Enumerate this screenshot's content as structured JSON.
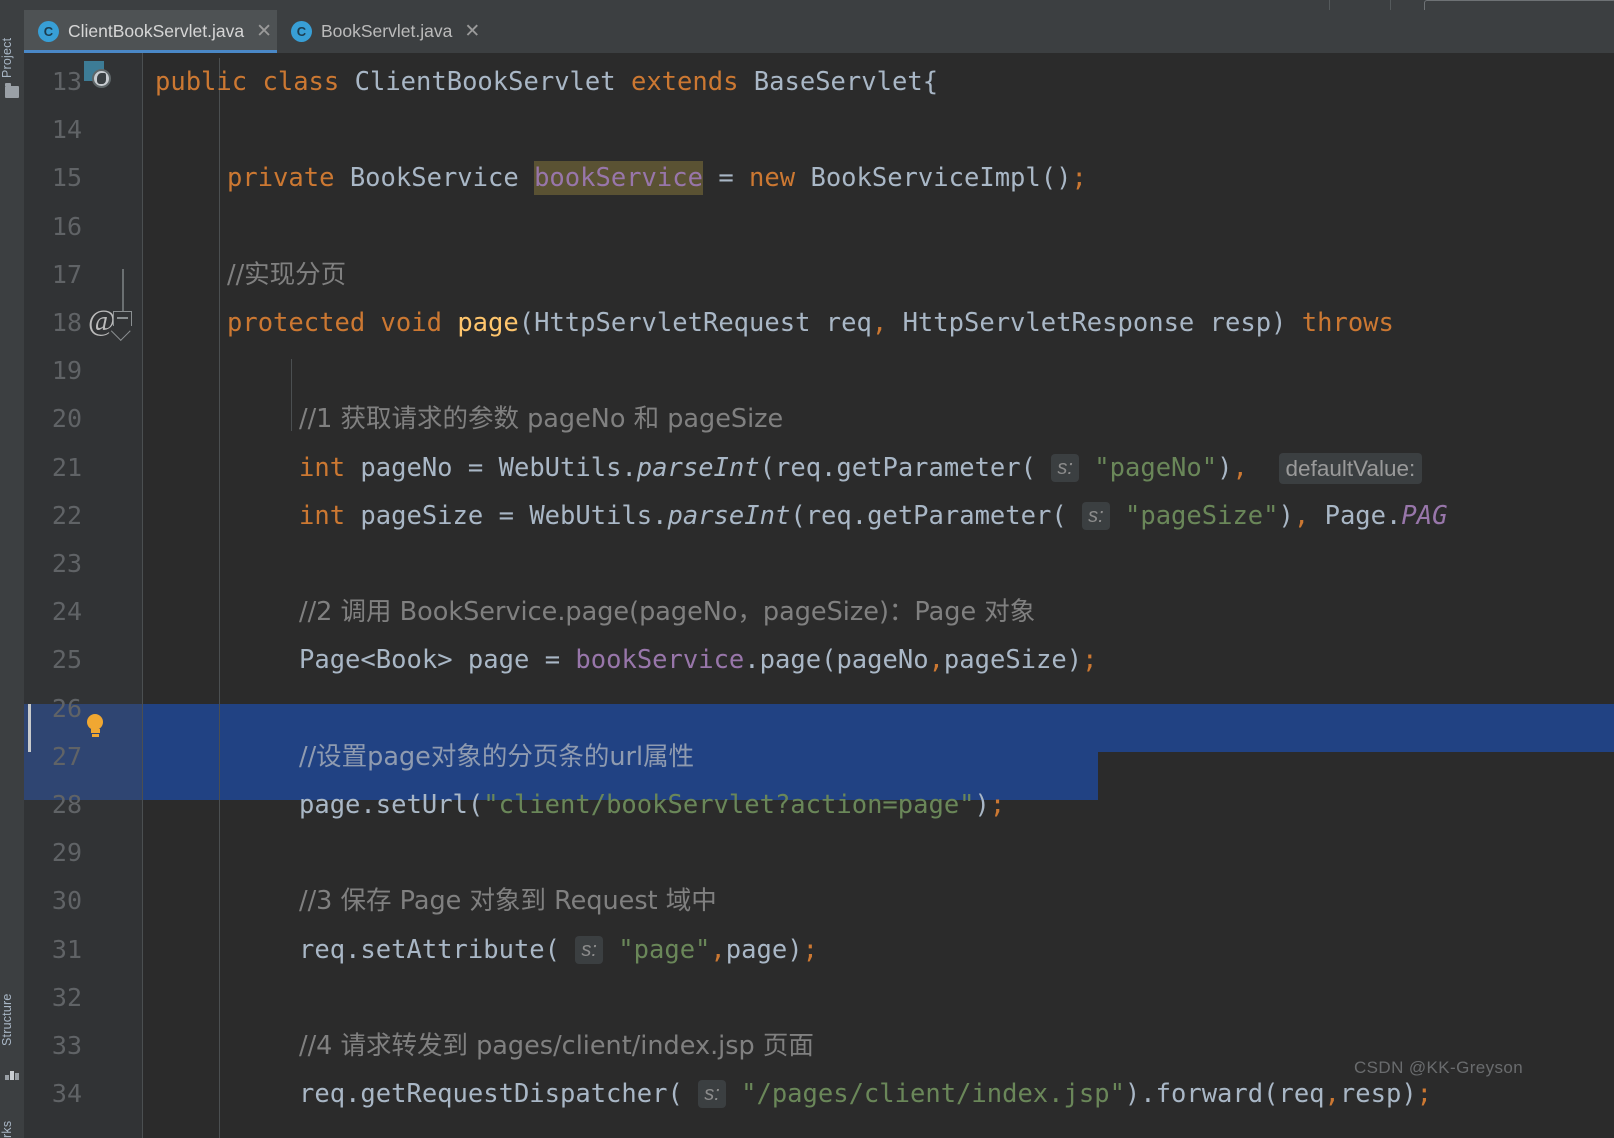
{
  "window": {
    "app": "IntelliJ IDEA",
    "theme_background": "#2b2b2b",
    "accent": "#4a88c7"
  },
  "toolwindows": {
    "left": [
      {
        "label": "Project",
        "icon": "folder-icon"
      },
      {
        "label": "Structure",
        "icon": "structure-icon"
      },
      {
        "label": "rks",
        "icon": "bookmarks-icon"
      }
    ]
  },
  "tabs": [
    {
      "label": "ClientBookServlet.java",
      "icon": "java-class-icon",
      "icon_letter": "C",
      "close": "✕",
      "active": true
    },
    {
      "label": "BookServlet.java",
      "icon": "java-class-icon",
      "icon_letter": "C",
      "close": "✕",
      "active": false
    }
  ],
  "editor": {
    "first_line": 13,
    "last_line": 34,
    "selected_lines": [
      27,
      28
    ],
    "gutter": {
      "servlet_marker_line": 13,
      "override_marker_line": 18,
      "override_glyph": "@",
      "fold_marker_line": 18,
      "intention_bulb_line": 27
    },
    "line_numbers": [
      "13",
      "14",
      "15",
      "16",
      "17",
      "18",
      "19",
      "20",
      "21",
      "22",
      "23",
      "24",
      "25",
      "26",
      "27",
      "28",
      "29",
      "30",
      "31",
      "32",
      "33",
      "34"
    ],
    "lines": [
      {
        "n": "13",
        "segments": [
          {
            "t": "public",
            "c": "kw"
          },
          {
            "t": " ",
            "c": "op"
          },
          {
            "t": "class",
            "c": "kw"
          },
          {
            "t": " ",
            "c": "op"
          },
          {
            "t": "ClientBookServlet",
            "c": "cls"
          },
          {
            "t": " ",
            "c": "op"
          },
          {
            "t": "extends",
            "c": "kw"
          },
          {
            "t": " ",
            "c": "op"
          },
          {
            "t": "BaseServlet",
            "c": "cls"
          },
          {
            "t": "{",
            "c": "punc"
          }
        ]
      },
      {
        "n": "14",
        "segments": []
      },
      {
        "n": "15",
        "indent": 1,
        "segments": [
          {
            "t": "private",
            "c": "kw"
          },
          {
            "t": " ",
            "c": "op"
          },
          {
            "t": "BookService",
            "c": "cls"
          },
          {
            "t": " ",
            "c": "op"
          },
          {
            "t": "bookService",
            "c": "fld hl-occurrence"
          },
          {
            "t": " ",
            "c": "op"
          },
          {
            "t": "=",
            "c": "op"
          },
          {
            "t": " ",
            "c": "op"
          },
          {
            "t": "new",
            "c": "kw"
          },
          {
            "t": " ",
            "c": "op"
          },
          {
            "t": "BookServiceImpl",
            "c": "cls"
          },
          {
            "t": "()",
            "c": "punc"
          },
          {
            "t": ";",
            "c": "semi"
          }
        ]
      },
      {
        "n": "16",
        "segments": []
      },
      {
        "n": "17",
        "indent": 1,
        "segments": [
          {
            "t": "//实现分页",
            "c": "cmt cmt-cn"
          }
        ]
      },
      {
        "n": "18",
        "indent": 1,
        "segments": [
          {
            "t": "protected",
            "c": "kw"
          },
          {
            "t": " ",
            "c": "op"
          },
          {
            "t": "void",
            "c": "kw"
          },
          {
            "t": " ",
            "c": "op"
          },
          {
            "t": "page",
            "c": "mth"
          },
          {
            "t": "(",
            "c": "punc"
          },
          {
            "t": "HttpServletRequest",
            "c": "cls"
          },
          {
            "t": " req",
            "c": "op"
          },
          {
            "t": ",",
            "c": "semi"
          },
          {
            "t": " ",
            "c": "op"
          },
          {
            "t": "HttpServletResponse",
            "c": "cls"
          },
          {
            "t": " resp",
            "c": "op"
          },
          {
            "t": ")",
            "c": "punc"
          },
          {
            "t": " ",
            "c": "op"
          },
          {
            "t": "throws",
            "c": "kw"
          }
        ]
      },
      {
        "n": "19",
        "segments": []
      },
      {
        "n": "20",
        "indent": 2,
        "segments": [
          {
            "t": "//1 获取请求的参数 pageNo 和 pageSize",
            "c": "cmt cmt-cn"
          }
        ]
      },
      {
        "n": "21",
        "indent": 2,
        "segments": [
          {
            "t": "int",
            "c": "kw"
          },
          {
            "t": " pageNo ",
            "c": "op"
          },
          {
            "t": "=",
            "c": "op"
          },
          {
            "t": " ",
            "c": "op"
          },
          {
            "t": "WebUtils",
            "c": "cls"
          },
          {
            "t": ".",
            "c": "punc"
          },
          {
            "t": "parseInt",
            "c": "stat"
          },
          {
            "t": "(",
            "c": "punc"
          },
          {
            "t": "req",
            "c": "op"
          },
          {
            "t": ".",
            "c": "punc"
          },
          {
            "t": "getParameter",
            "c": "op"
          },
          {
            "t": "(",
            "c": "punc"
          },
          {
            "t": " ",
            "c": "op"
          },
          {
            "t": "s:",
            "c": "hint"
          },
          {
            "t": " ",
            "c": "op"
          },
          {
            "t": "\"pageNo\"",
            "c": "str"
          },
          {
            "t": ")",
            "c": "punc"
          },
          {
            "t": ",",
            "c": "semi"
          },
          {
            "t": "  ",
            "c": "op"
          },
          {
            "t": "defaultValue:",
            "c": "hint-wide"
          }
        ]
      },
      {
        "n": "22",
        "indent": 2,
        "segments": [
          {
            "t": "int",
            "c": "kw"
          },
          {
            "t": " pageSize ",
            "c": "op"
          },
          {
            "t": "=",
            "c": "op"
          },
          {
            "t": " ",
            "c": "op"
          },
          {
            "t": "WebUtils",
            "c": "cls"
          },
          {
            "t": ".",
            "c": "punc"
          },
          {
            "t": "parseInt",
            "c": "stat"
          },
          {
            "t": "(",
            "c": "punc"
          },
          {
            "t": "req",
            "c": "op"
          },
          {
            "t": ".",
            "c": "punc"
          },
          {
            "t": "getParameter",
            "c": "op"
          },
          {
            "t": "(",
            "c": "punc"
          },
          {
            "t": " ",
            "c": "op"
          },
          {
            "t": "s:",
            "c": "hint"
          },
          {
            "t": " ",
            "c": "op"
          },
          {
            "t": "\"pageSize\"",
            "c": "str"
          },
          {
            "t": ")",
            "c": "punc"
          },
          {
            "t": ",",
            "c": "semi"
          },
          {
            "t": " ",
            "c": "op"
          },
          {
            "t": "Page",
            "c": "cls"
          },
          {
            "t": ".",
            "c": "punc"
          },
          {
            "t": "PAG",
            "c": "statf"
          }
        ]
      },
      {
        "n": "23",
        "segments": []
      },
      {
        "n": "24",
        "indent": 2,
        "segments": [
          {
            "t": "//2 调用 BookService.page(pageNo，pageSize)：Page 对象",
            "c": "cmt cmt-cn"
          }
        ]
      },
      {
        "n": "25",
        "indent": 2,
        "segments": [
          {
            "t": "Page",
            "c": "cls"
          },
          {
            "t": "<",
            "c": "punc"
          },
          {
            "t": "Book",
            "c": "cls"
          },
          {
            "t": ">",
            "c": "punc"
          },
          {
            "t": " page ",
            "c": "op"
          },
          {
            "t": "=",
            "c": "op"
          },
          {
            "t": " ",
            "c": "op"
          },
          {
            "t": "bookService",
            "c": "fld"
          },
          {
            "t": ".",
            "c": "punc"
          },
          {
            "t": "page",
            "c": "op"
          },
          {
            "t": "(",
            "c": "punc"
          },
          {
            "t": "pageNo",
            "c": "op"
          },
          {
            "t": ",",
            "c": "semi"
          },
          {
            "t": "pageSize",
            "c": "op"
          },
          {
            "t": ")",
            "c": "punc"
          },
          {
            "t": ";",
            "c": "semi"
          }
        ]
      },
      {
        "n": "26",
        "segments": []
      },
      {
        "n": "27",
        "indent": 2,
        "selected": true,
        "segments": [
          {
            "t": "//设置page对象的分页条的url属性",
            "c": "cnsel cmt-cn"
          }
        ]
      },
      {
        "n": "28",
        "indent": 2,
        "selected": true,
        "segments": [
          {
            "t": "page",
            "c": "op"
          },
          {
            "t": ".",
            "c": "punc"
          },
          {
            "t": "setUrl",
            "c": "op"
          },
          {
            "t": "(",
            "c": "punc"
          },
          {
            "t": "\"client/bookServlet?action=page\"",
            "c": "str"
          },
          {
            "t": ")",
            "c": "punc"
          },
          {
            "t": ";",
            "c": "semi"
          }
        ]
      },
      {
        "n": "29",
        "segments": []
      },
      {
        "n": "30",
        "indent": 2,
        "segments": [
          {
            "t": "//3 保存 Page 对象到 Request 域中",
            "c": "cmt cmt-cn"
          }
        ]
      },
      {
        "n": "31",
        "indent": 2,
        "segments": [
          {
            "t": "req",
            "c": "op"
          },
          {
            "t": ".",
            "c": "punc"
          },
          {
            "t": "setAttribute",
            "c": "op"
          },
          {
            "t": "(",
            "c": "punc"
          },
          {
            "t": " ",
            "c": "op"
          },
          {
            "t": "s:",
            "c": "hint"
          },
          {
            "t": " ",
            "c": "op"
          },
          {
            "t": "\"page\"",
            "c": "str"
          },
          {
            "t": ",",
            "c": "semi"
          },
          {
            "t": "page",
            "c": "op"
          },
          {
            "t": ")",
            "c": "punc"
          },
          {
            "t": ";",
            "c": "semi"
          }
        ]
      },
      {
        "n": "32",
        "segments": []
      },
      {
        "n": "33",
        "indent": 2,
        "segments": [
          {
            "t": "//4 请求转发到 pages/client/index.jsp 页面",
            "c": "cmt cmt-cn"
          }
        ]
      },
      {
        "n": "34",
        "indent": 2,
        "segments": [
          {
            "t": "req",
            "c": "op"
          },
          {
            "t": ".",
            "c": "punc"
          },
          {
            "t": "getRequestDispatcher",
            "c": "op"
          },
          {
            "t": "(",
            "c": "punc"
          },
          {
            "t": " ",
            "c": "op"
          },
          {
            "t": "s:",
            "c": "hint"
          },
          {
            "t": " ",
            "c": "op"
          },
          {
            "t": "\"/pages/client/index.jsp\"",
            "c": "str"
          },
          {
            "t": ")",
            "c": "punc"
          },
          {
            "t": ".",
            "c": "punc"
          },
          {
            "t": "forward",
            "c": "op"
          },
          {
            "t": "(",
            "c": "punc"
          },
          {
            "t": "req",
            "c": "op"
          },
          {
            "t": ",",
            "c": "semi"
          },
          {
            "t": "resp",
            "c": "op"
          },
          {
            "t": ")",
            "c": "punc"
          },
          {
            "t": ";",
            "c": "semi"
          }
        ]
      }
    ]
  },
  "watermark": {
    "text": "CSDN @KK-Greyson"
  },
  "colors": {
    "keyword": "#cc7832",
    "string": "#6a8759",
    "comment": "#808080",
    "field": "#9876aa",
    "method": "#ffc66d",
    "identifier": "#a9b7c6",
    "selection": "#214283",
    "occurrence_highlight": "#5a5233",
    "gutter_bg": "#313335",
    "editor_bg": "#2b2b2b",
    "tabbar_bg": "#3c3f41",
    "tab_active_bg": "#4e5254",
    "bulb": "#f0a732"
  }
}
